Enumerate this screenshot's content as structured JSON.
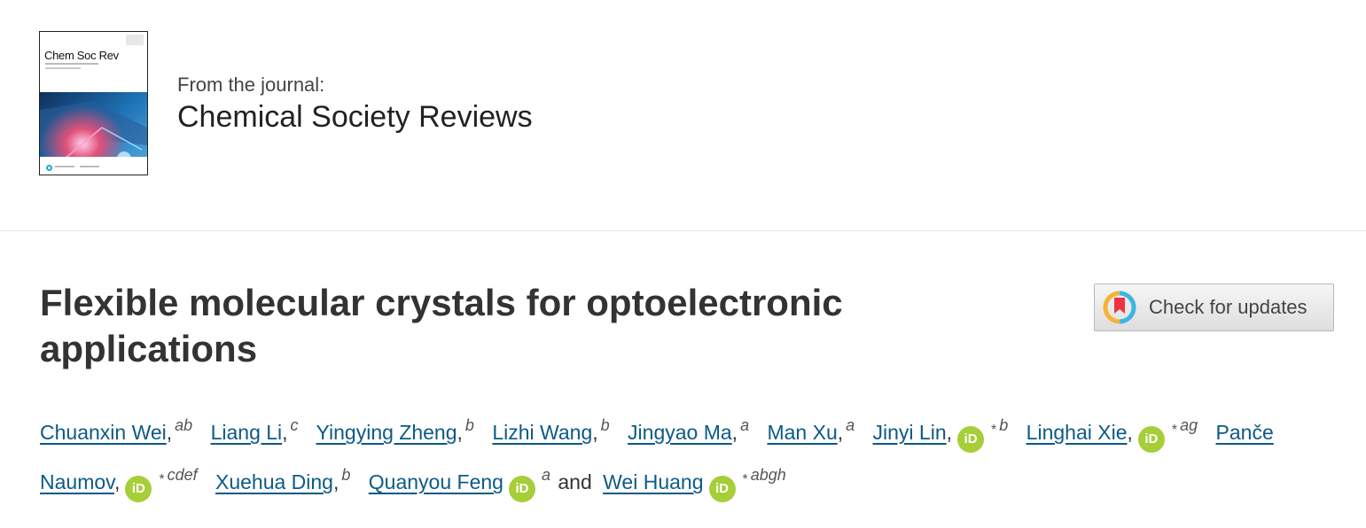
{
  "journal": {
    "cover_title": "Chem Soc Rev",
    "from_label": "From the journal:",
    "name": "Chemical Society Reviews"
  },
  "article": {
    "title": "Flexible molecular crystals for optoelectronic applications"
  },
  "check_updates": {
    "label": "Check for updates"
  },
  "authors": {
    "and_word": "and",
    "star": "*",
    "orcid_label": "iD",
    "list": [
      {
        "name": "Chuanxin Wei",
        "affil": "ab"
      },
      {
        "name": "Liang Li",
        "affil": "c"
      },
      {
        "name": "Yingying Zheng",
        "affil": "b"
      },
      {
        "name": "Lizhi Wang",
        "affil": "b"
      },
      {
        "name": "Jingyao Ma",
        "affil": "a"
      },
      {
        "name": "Man Xu",
        "affil": "a"
      },
      {
        "name": "Jinyi Lin",
        "affil": "b"
      },
      {
        "name": "Linghai Xie",
        "affil": "ag"
      },
      {
        "name_part1": "Panče",
        "name_part2": "Naumov",
        "affil": "cdef"
      },
      {
        "name": "Xuehua Ding",
        "affil": "b"
      },
      {
        "name": "Quanyou Feng",
        "affil": "a"
      },
      {
        "name": "Wei Huang",
        "affil": "abgh"
      }
    ]
  },
  "colors": {
    "link": "#0c5a87",
    "orcid": "#a6ce39",
    "title": "#333333"
  }
}
